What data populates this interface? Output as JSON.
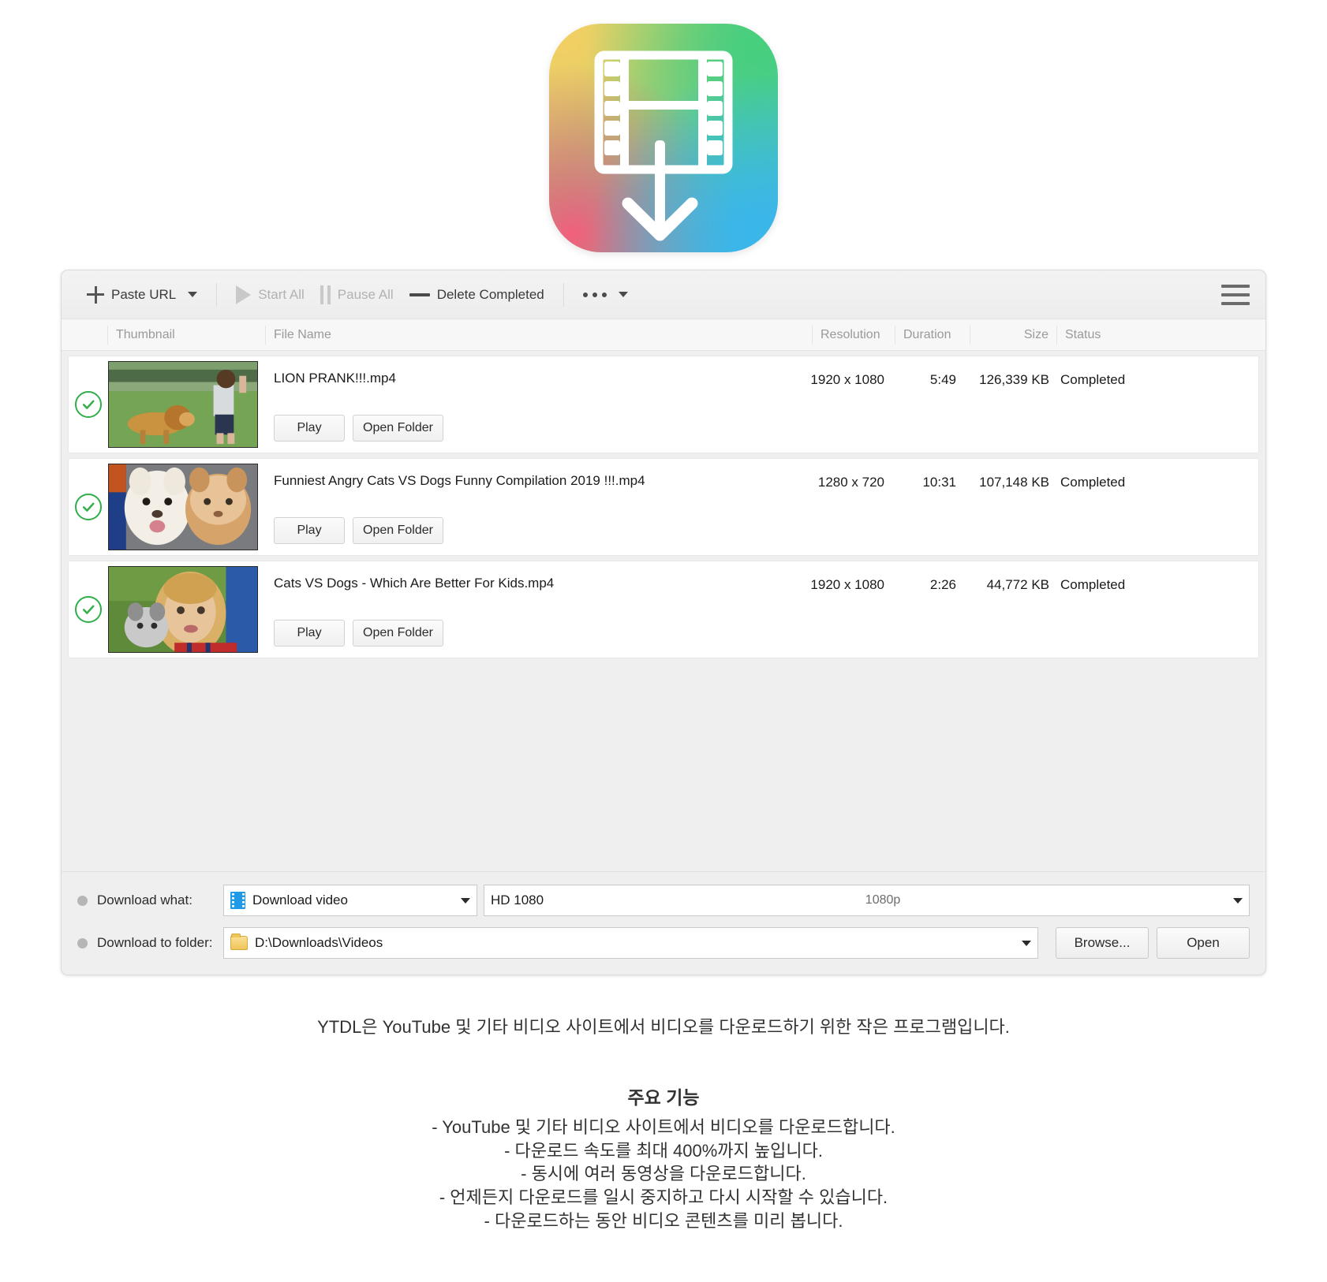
{
  "app_icon": {
    "name": "ytdl-app-icon",
    "gradient_colors": [
      "#ecd36a",
      "#7fce7c",
      "#43b4e8",
      "#f2607a"
    ],
    "glyph": "film-strip-download-arrow"
  },
  "toolbar": {
    "paste_url": "Paste URL",
    "start_all": "Start All",
    "pause_all": "Pause All",
    "delete_completed": "Delete Completed",
    "more_label": "",
    "menu_label": ""
  },
  "list": {
    "columns": {
      "check": "",
      "thumbnail": "Thumbnail",
      "file_name": "File Name",
      "resolution": "Resolution",
      "duration": "Duration",
      "size": "Size",
      "status": "Status"
    },
    "row_buttons": {
      "play": "Play",
      "open_folder": "Open Folder"
    },
    "rows": [
      {
        "checked": true,
        "thumbnail": "dog-lion-costume-chasing-boy",
        "file_name": "LION PRANK!!!.mp4",
        "resolution": "1920 x 1080",
        "duration": "5:49",
        "size": "126,339 KB",
        "status": "Completed"
      },
      {
        "checked": true,
        "thumbnail": "white-dog-and-ginger-cat",
        "file_name": "Funniest Angry Cats VS Dogs Funny Compilation 2019 !!!.mp4",
        "resolution": "1280 x 720",
        "duration": "10:31",
        "size": "107,148 KB",
        "status": "Completed"
      },
      {
        "checked": true,
        "thumbnail": "girl-holding-kitten",
        "file_name": "Cats VS Dogs - Which Are Better For Kids.mp4",
        "resolution": "1920 x 1080",
        "duration": "2:26",
        "size": "44,772 KB",
        "status": "Completed"
      }
    ]
  },
  "bottom": {
    "download_what_label": "Download what:",
    "download_what_value": "Download video",
    "quality_value": "HD 1080",
    "quality_suffix": "1080p",
    "download_to_folder_label": "Download to folder:",
    "folder_value": "D:\\Downloads\\Videos",
    "browse_button": "Browse...",
    "open_button": "Open"
  },
  "description": "YTDL은 YouTube 및 기타 비디오 사이트에서 비디오를 다운로드하기 위한 작은 프로그램입니다.",
  "features": {
    "title": "주요 기능",
    "items": [
      "- YouTube 및 기타 비디오 사이트에서 비디오를 다운로드합니다.",
      "- 다운로드 속도를 최대 400%까지 높입니다.",
      "- 동시에 여러 동영상을 다운로드합니다.",
      "- 언제든지 다운로드를 일시 중지하고 다시 시작할 수 있습니다.",
      "- 다운로드하는 동안 비디오 콘텐츠를 미리 봅니다."
    ]
  },
  "colors": {
    "accent_green": "#2fae4a",
    "window_bg": "#efeff0",
    "row_bg": "#ffffff"
  }
}
